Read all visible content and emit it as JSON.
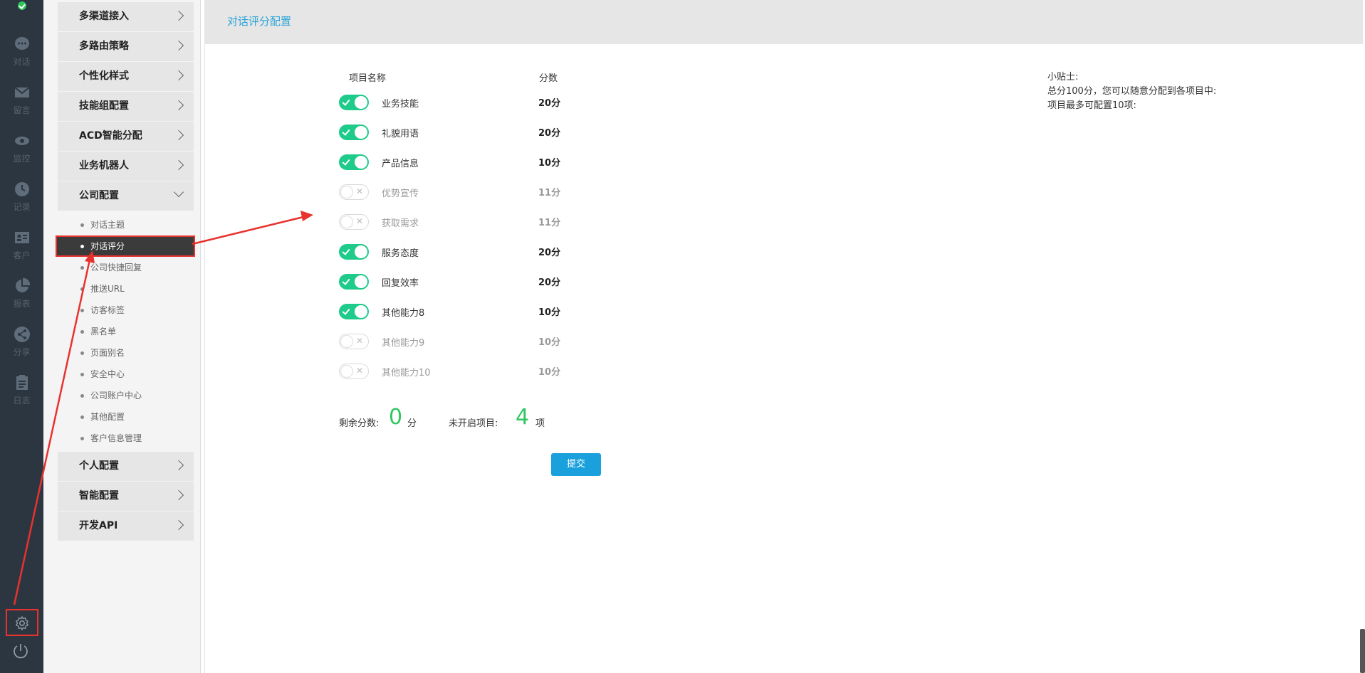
{
  "rail": {
    "items": [
      {
        "label": "对话",
        "icon": "chat-icon"
      },
      {
        "label": "留言",
        "icon": "mail-icon"
      },
      {
        "label": "监控",
        "icon": "eye-icon"
      },
      {
        "label": "记录",
        "icon": "clock-icon"
      },
      {
        "label": "客户",
        "icon": "contact-card-icon"
      },
      {
        "label": "报表",
        "icon": "pie-chart-icon"
      },
      {
        "label": "分享",
        "icon": "share-icon"
      },
      {
        "label": "日志",
        "icon": "clipboard-icon"
      }
    ]
  },
  "menu": {
    "groups_top": [
      "多渠道接入",
      "多路由策略",
      "个性化样式",
      "技能组配置",
      "ACD智能分配",
      "业务机器人"
    ],
    "open_group": "公司配置",
    "sub_items": [
      "对话主题",
      "对话评分",
      "公司快捷回复",
      "推送URL",
      "访客标签",
      "黑名单",
      "页面别名",
      "安全中心",
      "公司账户中心",
      "其他配置",
      "客户信息管理"
    ],
    "active_sub": "对话评分",
    "groups_bottom": [
      "个人配置",
      "智能配置",
      "开发API"
    ]
  },
  "page": {
    "title": "对话评分配置",
    "col_name": "项目名称",
    "col_score": "分数"
  },
  "rows": [
    {
      "name": "业务技能",
      "score": "20分",
      "enabled": true
    },
    {
      "name": "礼貌用语",
      "score": "20分",
      "enabled": true
    },
    {
      "name": "产品信息",
      "score": "10分",
      "enabled": true
    },
    {
      "name": "优势宣传",
      "score": "11分",
      "enabled": false
    },
    {
      "name": "获取需求",
      "score": "11分",
      "enabled": false
    },
    {
      "name": "服务态度",
      "score": "20分",
      "enabled": true
    },
    {
      "name": "回复效率",
      "score": "20分",
      "enabled": true
    },
    {
      "name": "其他能力8",
      "score": "10分",
      "enabled": true
    },
    {
      "name": "其他能力9",
      "score": "10分",
      "enabled": false
    },
    {
      "name": "其他能力10",
      "score": "10分",
      "enabled": false
    }
  ],
  "summary": {
    "remaining_label": "剩余分数:",
    "remaining_value": "0",
    "remaining_unit": "分",
    "unopened_label": "未开启项目:",
    "unopened_value": "4",
    "unopened_unit": "项"
  },
  "submit_label": "提交",
  "tips": {
    "title": "小贴士:",
    "line1": "总分100分，您可以随意分配到各项目中:",
    "line2": "项目最多可配置10项:"
  },
  "colors": {
    "accent": "#1aa0dc",
    "toggle_on": "#1ecb8a",
    "highlight": "#e8322e",
    "value_green": "#2fc760"
  }
}
